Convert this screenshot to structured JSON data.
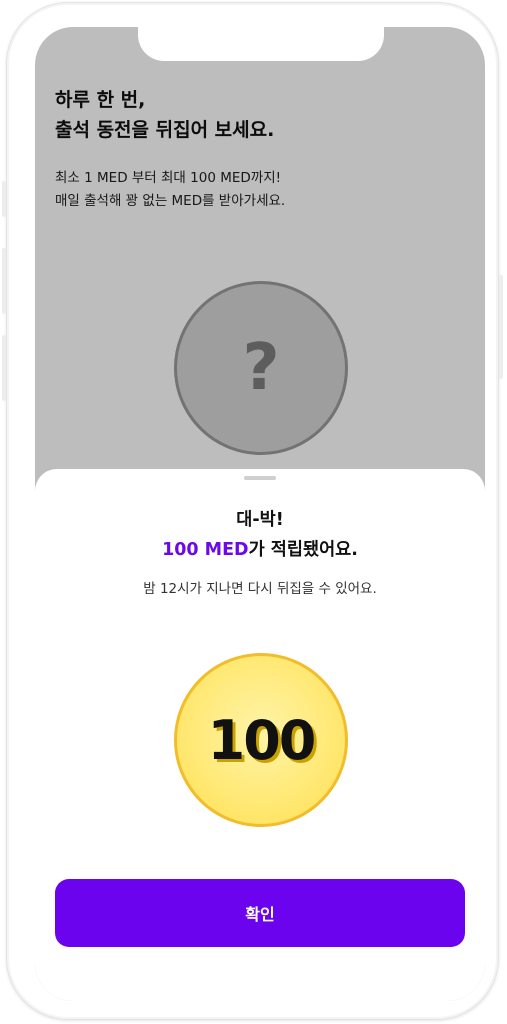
{
  "background_page": {
    "headline": [
      "하루 한 번,",
      "출석 동전을 뒤집어 보세요."
    ],
    "description": [
      "최소 1 MED 부터 최대 100 MED까지!",
      "매일 출석해 꽝 없는 MED를 받아가세요."
    ],
    "mystery_coin_symbol": "?"
  },
  "sheet": {
    "title_line1": "대-박!",
    "title_amount": "100 MED",
    "title_suffix": "가 적립됐어요.",
    "subtitle": "밤 12시가 지나면 다시 뒤집을 수 있어요.",
    "coin_value": "100",
    "confirm_label": "확인"
  },
  "colors": {
    "accent": "#6c09e8",
    "button": "#6c03ee",
    "coin_fill": "#ffe66a",
    "coin_border": "#f2bd2a",
    "dim_overlay": "rgba(0,0,0,0.26)"
  },
  "icons": {
    "mystery_coin": "question-mark-coin-icon",
    "reward_coin": "gold-coin-icon"
  }
}
